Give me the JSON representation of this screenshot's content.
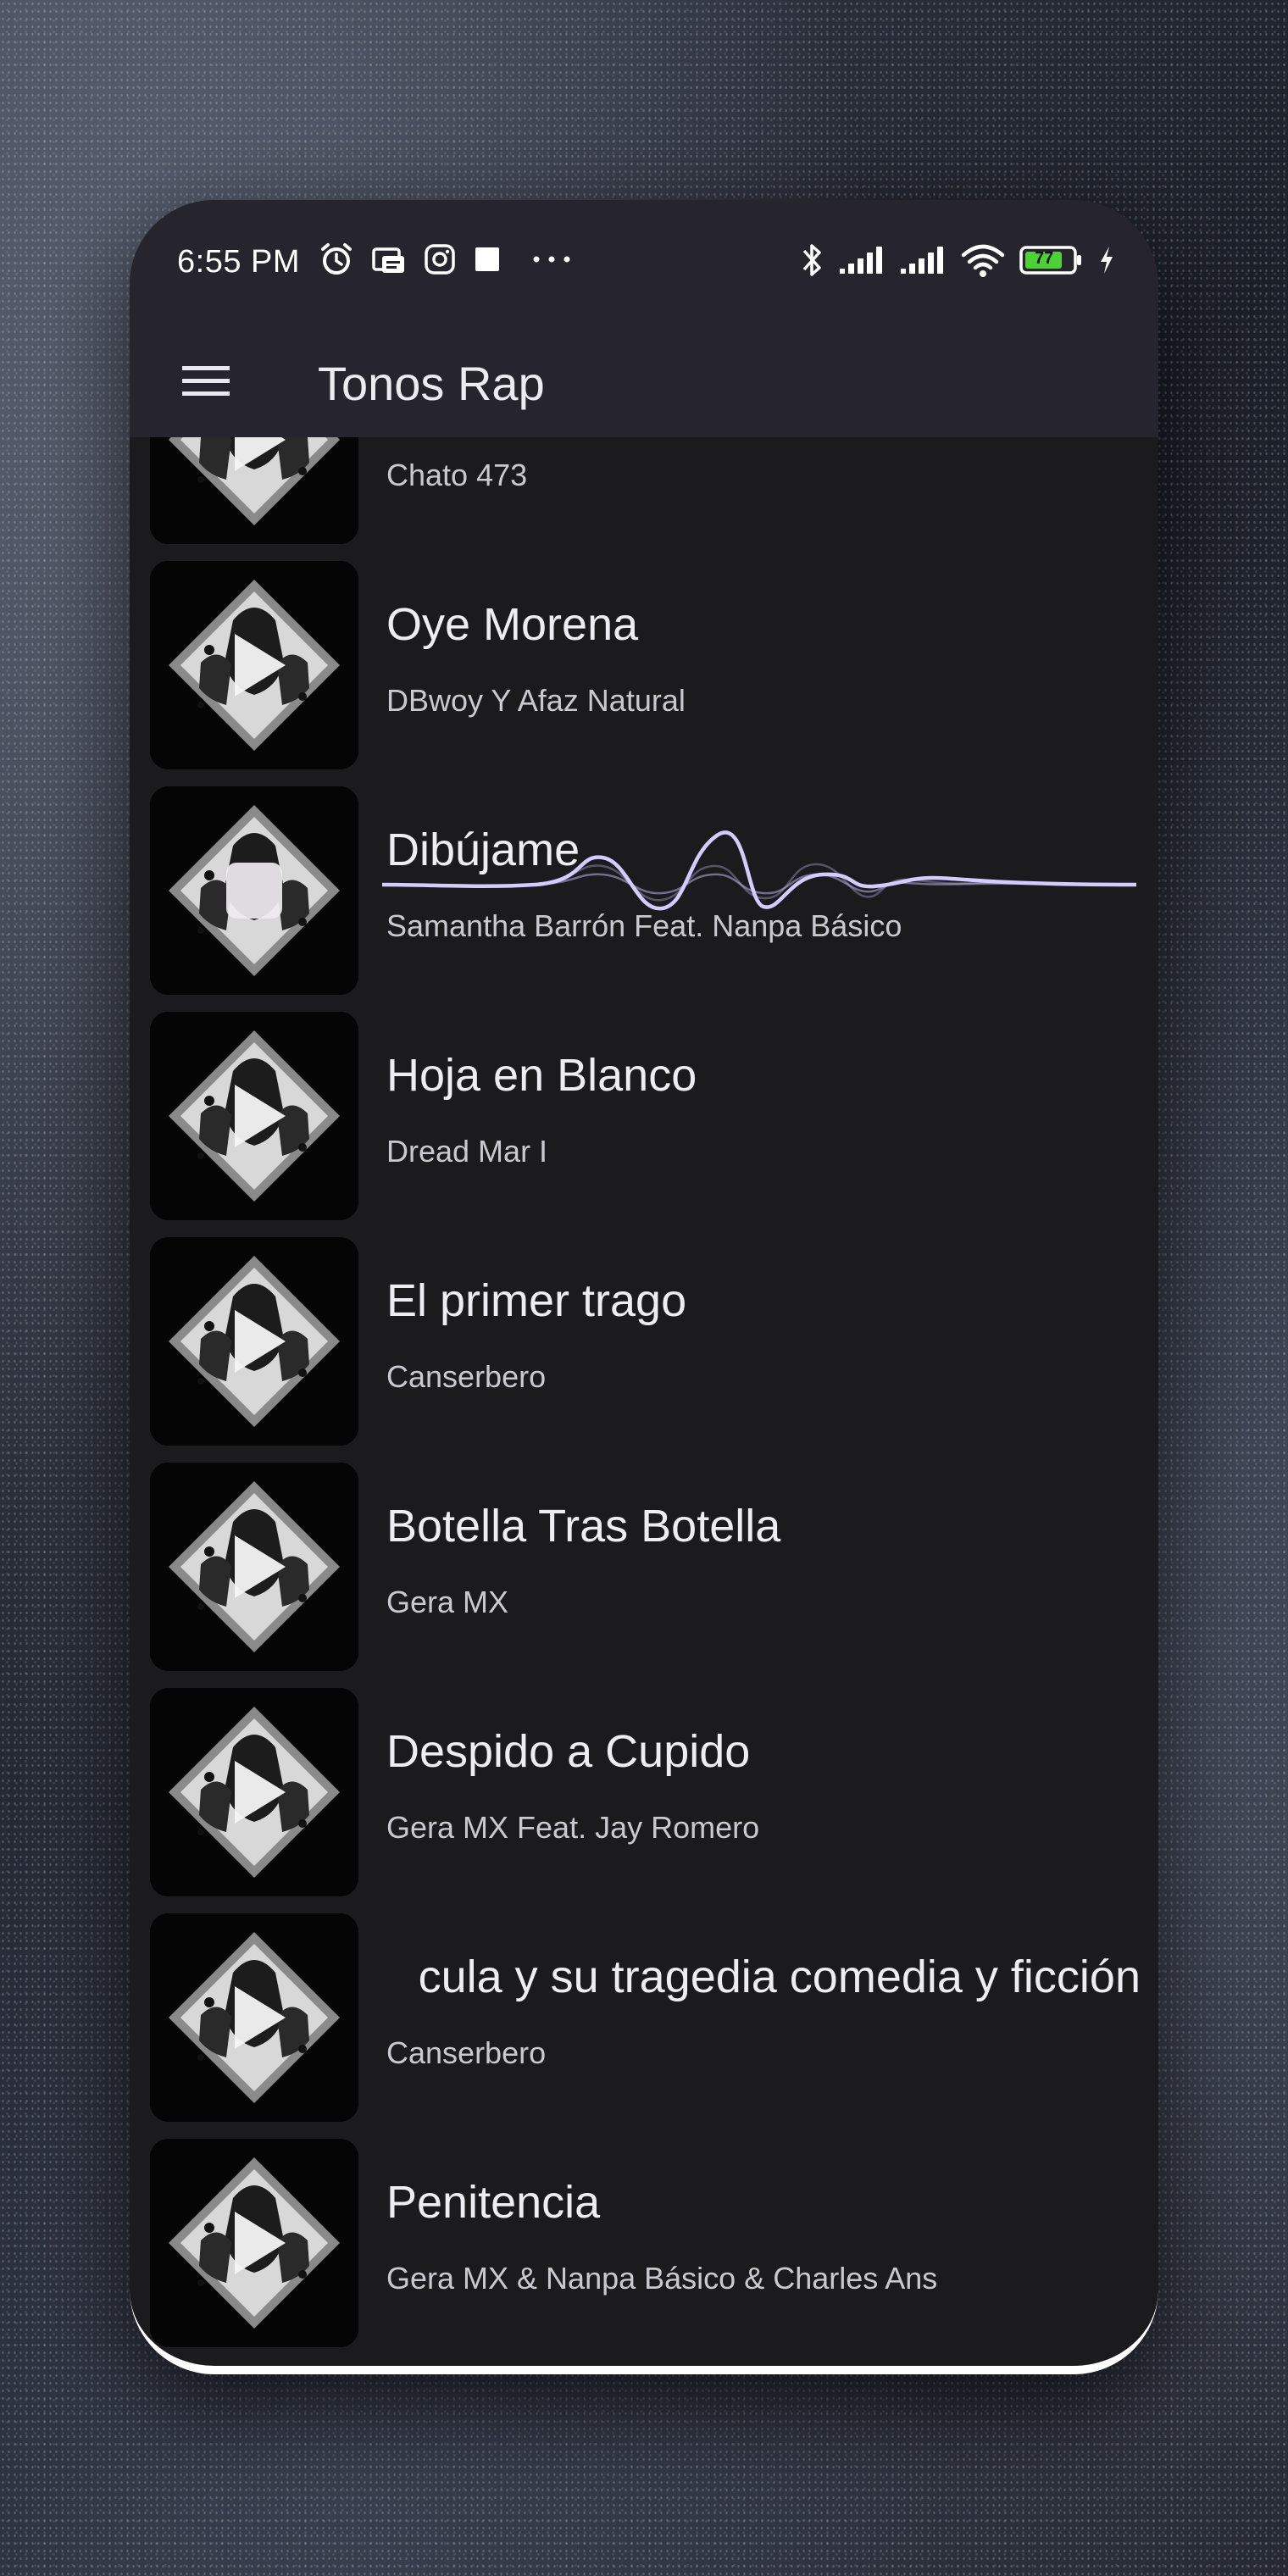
{
  "status_bar": {
    "time": "6:55 PM",
    "battery": "77",
    "left_icons": [
      "alarm-icon",
      "notification-icon",
      "instagram-icon",
      "square-icon",
      "more-icon"
    ],
    "right_icons": [
      "bluetooth-icon",
      "signal-icon",
      "signal-icon",
      "wifi-icon",
      "battery-icon",
      "charging-icon"
    ]
  },
  "toolbar": {
    "title": "Tonos Rap",
    "menu_icon": "hamburger-menu-icon"
  },
  "songs": [
    {
      "title": "",
      "artist": "Chato 473"
    },
    {
      "title": "Oye Morena",
      "artist": "DBwoy Y Afaz Natural"
    },
    {
      "title": "Dibújame",
      "artist": "Samantha Barrón Feat. Nanpa Básico",
      "playing": true
    },
    {
      "title": "Hoja en Blanco",
      "artist": "Dread Mar I"
    },
    {
      "title": "El primer trago",
      "artist": "Canserbero"
    },
    {
      "title": "Botella Tras Botella",
      "artist": "Gera MX"
    },
    {
      "title": "Despido a Cupido",
      "artist": "Gera MX Feat. Jay Romero"
    },
    {
      "title": "cula y su tragedia comedia y ficción",
      "artist": "Canserbero",
      "marquee": true
    },
    {
      "title": "Penitencia",
      "artist": "Gera MX & Nanpa Básico & Charles Ans"
    }
  ],
  "colors": {
    "app_bar": "#26252d",
    "list_background": "#1b1b1e",
    "waveform": "#c9bff5",
    "battery_fill": "#4cd137"
  }
}
